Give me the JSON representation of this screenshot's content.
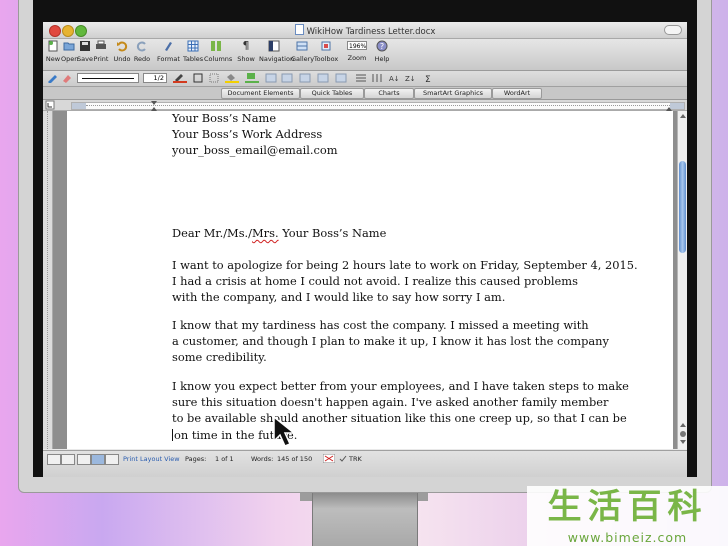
{
  "window": {
    "title": "WikiHow Tardiness Letter.docx"
  },
  "toolbar": {
    "items": [
      {
        "label": "New"
      },
      {
        "label": "Open"
      },
      {
        "label": "Save"
      },
      {
        "label": "Print"
      },
      {
        "label": "Undo"
      },
      {
        "label": "Redo"
      },
      {
        "label": "Format"
      },
      {
        "label": "Tables"
      },
      {
        "label": "Columns"
      },
      {
        "label": "Show"
      },
      {
        "label": "Navigation"
      },
      {
        "label": "Gallery"
      },
      {
        "label": "Toolbox"
      },
      {
        "label": "Zoom"
      },
      {
        "label": "Help"
      }
    ],
    "zoom_value": "196%"
  },
  "format_bar": {
    "line_weight": "1/2"
  },
  "ribbon": {
    "tabs": [
      "Document Elements",
      "Quick Tables",
      "Charts",
      "SmartArt Graphics",
      "WordArt"
    ]
  },
  "letter": {
    "recipient": [
      "Your Boss’s Name",
      "Your Boss’s Work Address",
      "your_boss_email@email.com"
    ],
    "salutation_prefix": "Dear Mr./Ms./",
    "salutation_flagged": "Mrs.",
    "salutation_suffix": " Your Boss’s Name",
    "paragraph_1": [
      "I want to apologize for being 2 hours late to work on Friday, September 4, 2015.",
      "I had a crisis at home I could not avoid. I realize this caused problems",
      "with the company, and I would like to say how sorry I am."
    ],
    "paragraph_2": [
      "I know that my tardiness has cost the company. I missed a meeting with",
      "a customer, and though I plan to make it up, I know it has lost the company",
      "some credibility."
    ],
    "paragraph_3": [
      "I know you expect better from your employees, and I have taken steps to make",
      "sure this situation doesn't happen again. I've asked another family member",
      "to be available should another situation like this one creep up, so that I can be",
      "on time in the future."
    ]
  },
  "status": {
    "view": "Print Layout View",
    "pages_label": "Pages:",
    "pages_value": "1 of 1",
    "words_label": "Words:",
    "words_value": "145 of 150",
    "trk": "TRK"
  },
  "watermark": {
    "chinese": "生活百科",
    "url": "www.bimeiz.com"
  }
}
